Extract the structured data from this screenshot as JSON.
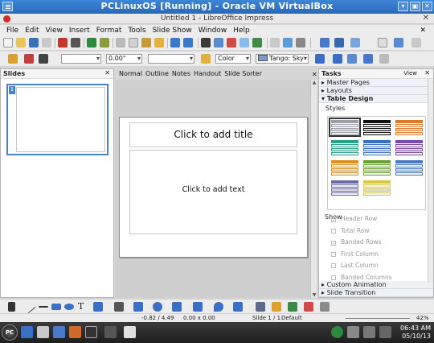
{
  "vbox": {
    "title": "PCLinuxOS [Running] - Oracle VM VirtualBox",
    "min": "▾",
    "restore": "▣",
    "close": "✕"
  },
  "lo": {
    "title": "Untitled 1 - LibreOffice Impress",
    "close": "✕"
  },
  "menu": [
    "File",
    "Edit",
    "View",
    "Insert",
    "Format",
    "Tools",
    "Slide Show",
    "Window",
    "Help"
  ],
  "menu_close": "✕",
  "toolbar2": {
    "line_width": "0.00\"",
    "line_style": "",
    "area_fill": "Color",
    "area_color": "Tango: Sky"
  },
  "slides_pane": {
    "title": "Slides",
    "close": "✕",
    "slide_number": "1"
  },
  "view_tabs": [
    "Normal",
    "Outline",
    "Notes",
    "Handout",
    "Slide Sorter"
  ],
  "view_close": "✕",
  "slide": {
    "title_placeholder": "Click to add title",
    "text_placeholder": "Click to add text"
  },
  "tasks": {
    "title": "Tasks",
    "view_label": "View",
    "close": "✕",
    "sections_top": [
      "Master Pages",
      "Layouts",
      "Table Design"
    ],
    "styles_label": "Styles",
    "show_label": "Show",
    "options": [
      {
        "label": "Header Row",
        "checked": true
      },
      {
        "label": "Total Row",
        "checked": false
      },
      {
        "label": "Banded Rows",
        "checked": true
      },
      {
        "label": "First Column",
        "checked": false
      },
      {
        "label": "Last Column",
        "checked": false
      },
      {
        "label": "Banded Columns",
        "checked": false
      }
    ],
    "sections_bottom": [
      "Custom Animation",
      "Slide Transition"
    ],
    "table_style_colors": [
      "#9aa0a8",
      "#111111",
      "#e07a2a",
      "#2aa08c",
      "#3a6fc4",
      "#7a4aa8",
      "#d9901e",
      "#6aa030",
      "#4a78c8",
      "#6a6aa8",
      "#d8c840"
    ]
  },
  "status": {
    "position": "-0.82 / 4.49",
    "size": "0.00 x 0.00",
    "slide": "Slide 1 / 1",
    "master": "Default",
    "zoom": "42%"
  },
  "taskbar": {
    "start": "PC",
    "time": "06:43 AM",
    "date": "05/10/13"
  }
}
